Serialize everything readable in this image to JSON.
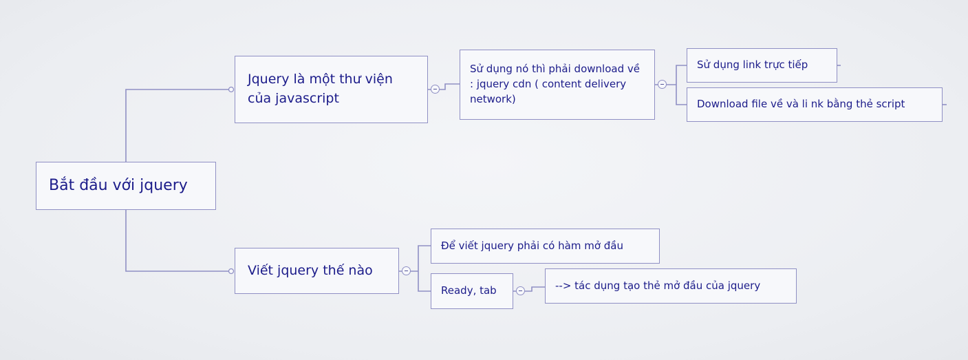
{
  "mindmap": {
    "root": {
      "label": "Bắt đầu với jquery"
    },
    "branch_1": {
      "label": "Jquery là một thư viện của javascript",
      "child": {
        "label": "Sử dụng nó thì phải download về : jquery cdn ( content delivery network)",
        "children": [
          {
            "label": "Sử dụng link trực tiếp"
          },
          {
            "label": "Download file về và li nk bằng thẻ script"
          }
        ]
      }
    },
    "branch_2": {
      "label": "Viết jquery thế nào",
      "children": [
        {
          "label": "Để viết jquery phải có hàm mở đầu"
        },
        {
          "label": "Ready, tab",
          "child": {
            "label": "--> tác dụng tạo thẻ mở đầu của jquery"
          }
        }
      ]
    }
  },
  "colors": {
    "text": "#1c1c8a",
    "border": "#8f8fc4",
    "connector": "#8f8fc4",
    "node_fill": "#f7f8fb",
    "background": "#eeeff3"
  }
}
